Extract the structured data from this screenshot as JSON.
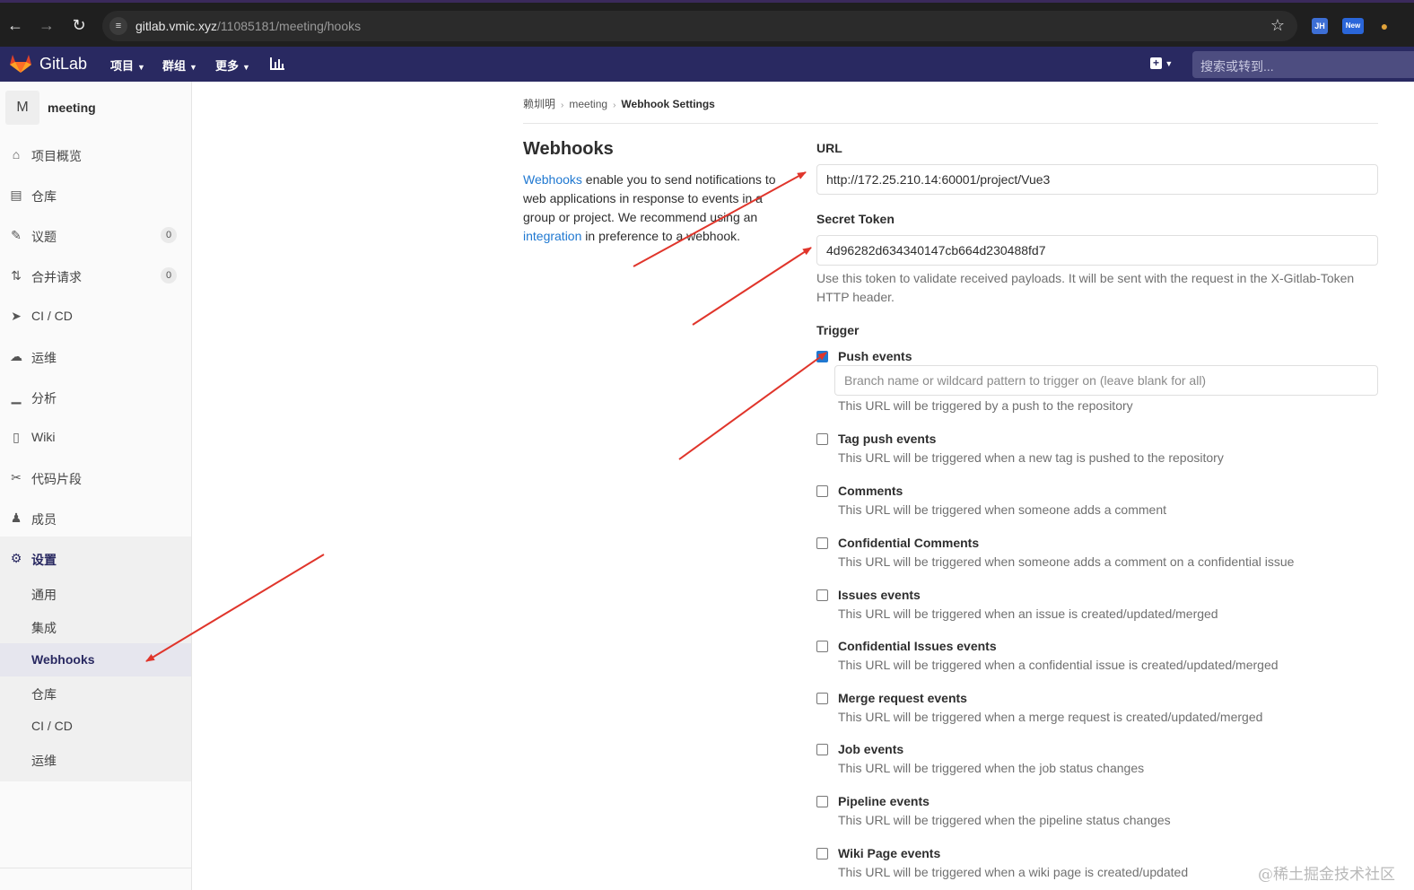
{
  "browser": {
    "url_host": "gitlab.vmic.xyz",
    "url_path": "/11085181/meeting/hooks",
    "ext_new_label": "New",
    "ext_jh_label": "JH"
  },
  "topnav": {
    "brand": "GitLab",
    "menus": [
      "项目",
      "群组",
      "更多"
    ],
    "search_placeholder": "搜索或转到..."
  },
  "sidebar": {
    "avatar_letter": "M",
    "project_name": "meeting",
    "items": [
      {
        "label": "项目概览",
        "icon": "home-icon"
      },
      {
        "label": "仓库",
        "icon": "doc-icon"
      },
      {
        "label": "议题",
        "icon": "issues-icon",
        "count": "0"
      },
      {
        "label": "合并请求",
        "icon": "merge-icon",
        "count": "0"
      },
      {
        "label": "CI / CD",
        "icon": "rocket-icon"
      },
      {
        "label": "运维",
        "icon": "cloud-icon"
      },
      {
        "label": "分析",
        "icon": "chart-icon"
      },
      {
        "label": "Wiki",
        "icon": "book-icon"
      },
      {
        "label": "代码片段",
        "icon": "scissors-icon"
      },
      {
        "label": "成员",
        "icon": "users-icon"
      },
      {
        "label": "设置",
        "icon": "gear-icon"
      }
    ],
    "settings_sub": [
      "通用",
      "集成",
      "Webhooks",
      "仓库",
      "CI / CD",
      "运维"
    ]
  },
  "breadcrumb": [
    "赖圳明",
    "meeting",
    "Webhook Settings"
  ],
  "intro": {
    "title": "Webhooks",
    "link1": "Webhooks",
    "text1": " enable you to send notifications to web applications in response to events in a group or project. We recommend using an ",
    "link2": "integration",
    "text2": " in preference to a webhook."
  },
  "form": {
    "url_label": "URL",
    "url_value": "http://172.25.210.14:60001/project/Vue3",
    "token_label": "Secret Token",
    "token_value": "4d96282d634340147cb664d230488fd7",
    "token_help": "Use this token to validate received payloads. It will be sent with the request in the X-Gitlab-Token HTTP header.",
    "trigger_label": "Trigger",
    "branch_placeholder": "Branch name or wildcard pattern to trigger on (leave blank for all)"
  },
  "events": [
    {
      "title": "Push events",
      "desc": "This URL will be triggered by a push to the repository",
      "checked": true
    },
    {
      "title": "Tag push events",
      "desc": "This URL will be triggered when a new tag is pushed to the repository",
      "checked": false
    },
    {
      "title": "Comments",
      "desc": "This URL will be triggered when someone adds a comment",
      "checked": false
    },
    {
      "title": "Confidential Comments",
      "desc": "This URL will be triggered when someone adds a comment on a confidential issue",
      "checked": false
    },
    {
      "title": "Issues events",
      "desc": "This URL will be triggered when an issue is created/updated/merged",
      "checked": false
    },
    {
      "title": "Confidential Issues events",
      "desc": "This URL will be triggered when a confidential issue is created/updated/merged",
      "checked": false
    },
    {
      "title": "Merge request events",
      "desc": "This URL will be triggered when a merge request is created/updated/merged",
      "checked": false
    },
    {
      "title": "Job events",
      "desc": "This URL will be triggered when the job status changes",
      "checked": false
    },
    {
      "title": "Pipeline events",
      "desc": "This URL will be triggered when the pipeline status changes",
      "checked": false
    },
    {
      "title": "Wiki Page events",
      "desc": "This URL will be triggered when a wiki page is created/updated",
      "checked": false
    }
  ],
  "watermark": "@稀土掘金技术社区",
  "colors": {
    "nav": "#292961",
    "link": "#1f78d1",
    "annotation_arrow": "#e0352b"
  }
}
